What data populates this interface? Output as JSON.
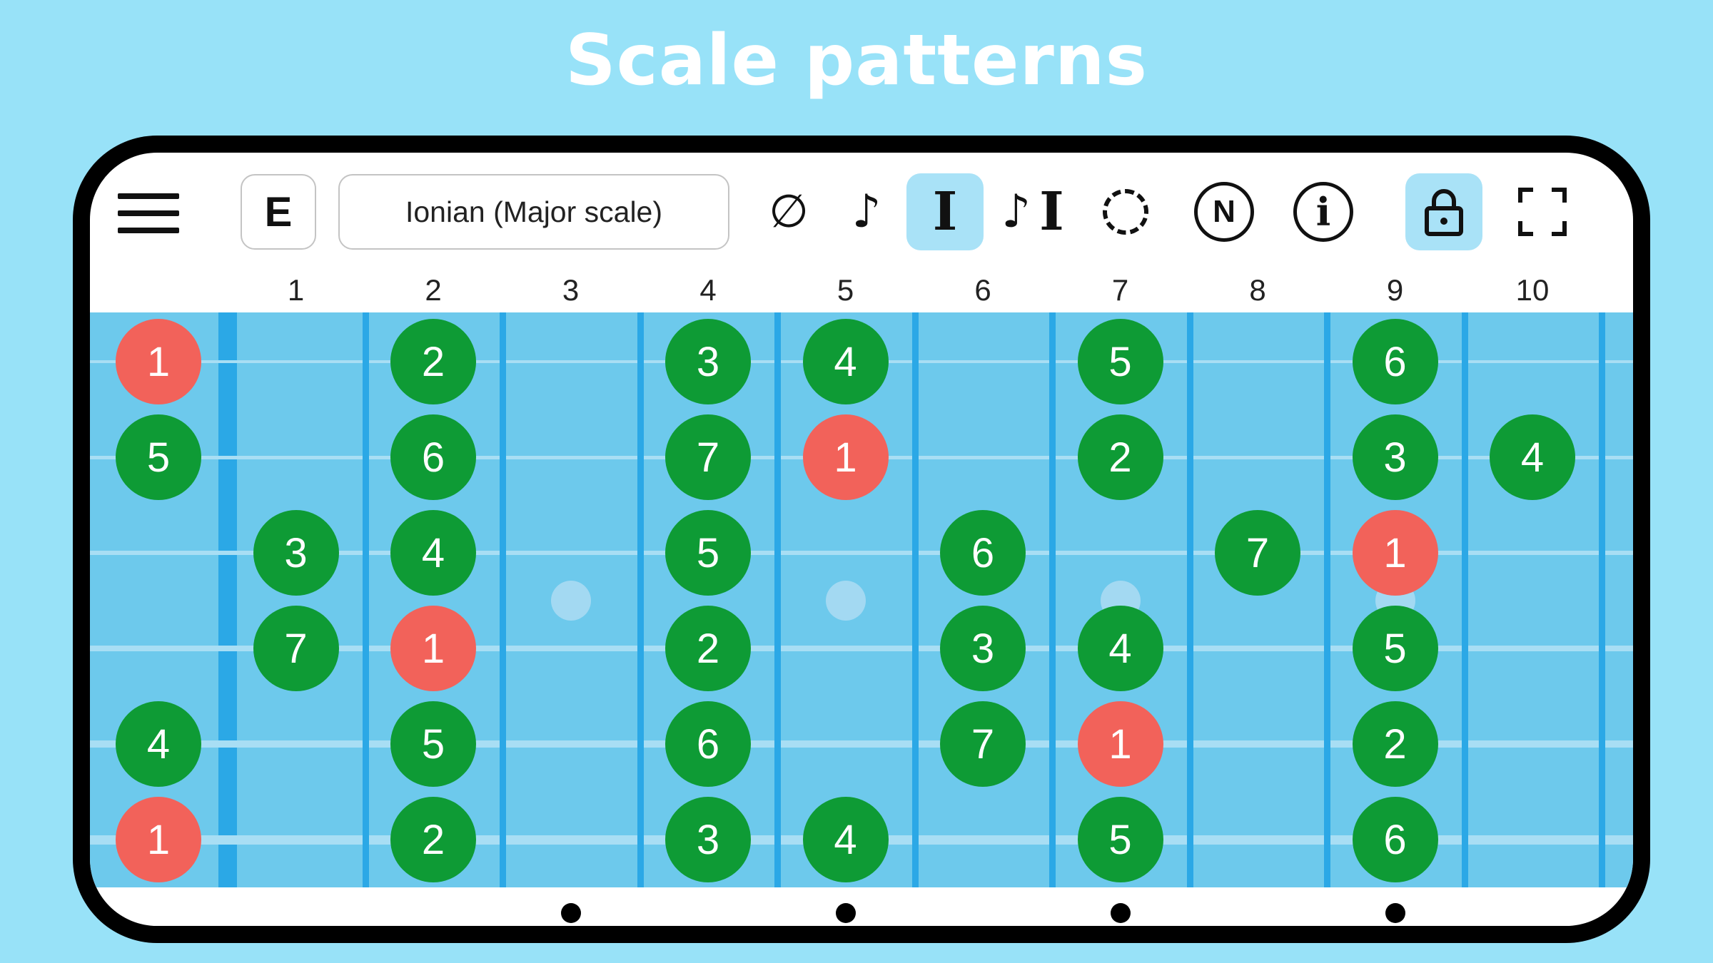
{
  "headline": "Scale patterns",
  "toolbar": {
    "menu_icon": "hamburger-menu-icon",
    "key_label": "E",
    "scale_label": "Ionian (Major scale)",
    "buttons": [
      {
        "name": "hide-notes-button",
        "icon": "empty-set-icon",
        "glyph": "∅",
        "active": false
      },
      {
        "name": "sound-button",
        "icon": "eighth-note-icon",
        "glyph": "♪",
        "active": false
      },
      {
        "name": "intervals-button",
        "icon": "interval-icon",
        "glyph": "I",
        "active": true
      },
      {
        "name": "sound-intervals-button",
        "icon": "note-interval-icon",
        "glyph": "♪",
        "glyph2": "I",
        "active": false
      },
      {
        "name": "circle-mode-button",
        "icon": "dashed-circle-icon",
        "active": false
      },
      {
        "name": "note-names-button",
        "icon": "n-circle-icon",
        "glyph": "N",
        "active": false
      },
      {
        "name": "info-button",
        "icon": "info-icon",
        "glyph": "i",
        "active": false
      },
      {
        "name": "lock-button",
        "icon": "lock-icon",
        "active": true
      },
      {
        "name": "fullscreen-button",
        "icon": "fullscreen-icon",
        "active": false
      }
    ]
  },
  "fret_numbers": [
    "1",
    "2",
    "3",
    "4",
    "5",
    "6",
    "7",
    "8",
    "9",
    "10"
  ],
  "colors": {
    "root": "#f2625a",
    "scale": "#0e9b35",
    "fretboard": "#6dc9ec",
    "fret": "#2ba8e6",
    "accent": "#a9e2f7"
  },
  "fretboard": {
    "strings": 6,
    "single_inlays": [
      3,
      5,
      7,
      9
    ],
    "bottom_markers": [
      3,
      5,
      7,
      9
    ],
    "notes": [
      {
        "string": 1,
        "fret": 0,
        "label": "1",
        "root": true
      },
      {
        "string": 1,
        "fret": 2,
        "label": "2",
        "root": false
      },
      {
        "string": 1,
        "fret": 4,
        "label": "3",
        "root": false
      },
      {
        "string": 1,
        "fret": 5,
        "label": "4",
        "root": false
      },
      {
        "string": 1,
        "fret": 7,
        "label": "5",
        "root": false
      },
      {
        "string": 1,
        "fret": 9,
        "label": "6",
        "root": false
      },
      {
        "string": 2,
        "fret": 0,
        "label": "5",
        "root": false
      },
      {
        "string": 2,
        "fret": 2,
        "label": "6",
        "root": false
      },
      {
        "string": 2,
        "fret": 4,
        "label": "7",
        "root": false
      },
      {
        "string": 2,
        "fret": 5,
        "label": "1",
        "root": true
      },
      {
        "string": 2,
        "fret": 7,
        "label": "2",
        "root": false
      },
      {
        "string": 2,
        "fret": 9,
        "label": "3",
        "root": false
      },
      {
        "string": 2,
        "fret": 10,
        "label": "4",
        "root": false
      },
      {
        "string": 3,
        "fret": 1,
        "label": "3",
        "root": false
      },
      {
        "string": 3,
        "fret": 2,
        "label": "4",
        "root": false
      },
      {
        "string": 3,
        "fret": 4,
        "label": "5",
        "root": false
      },
      {
        "string": 3,
        "fret": 6,
        "label": "6",
        "root": false
      },
      {
        "string": 3,
        "fret": 8,
        "label": "7",
        "root": false
      },
      {
        "string": 3,
        "fret": 9,
        "label": "1",
        "root": true
      },
      {
        "string": 4,
        "fret": 1,
        "label": "7",
        "root": false
      },
      {
        "string": 4,
        "fret": 2,
        "label": "1",
        "root": true
      },
      {
        "string": 4,
        "fret": 4,
        "label": "2",
        "root": false
      },
      {
        "string": 4,
        "fret": 6,
        "label": "3",
        "root": false
      },
      {
        "string": 4,
        "fret": 7,
        "label": "4",
        "root": false
      },
      {
        "string": 4,
        "fret": 9,
        "label": "5",
        "root": false
      },
      {
        "string": 5,
        "fret": 0,
        "label": "4",
        "root": false
      },
      {
        "string": 5,
        "fret": 2,
        "label": "5",
        "root": false
      },
      {
        "string": 5,
        "fret": 4,
        "label": "6",
        "root": false
      },
      {
        "string": 5,
        "fret": 6,
        "label": "7",
        "root": false
      },
      {
        "string": 5,
        "fret": 7,
        "label": "1",
        "root": true
      },
      {
        "string": 5,
        "fret": 9,
        "label": "2",
        "root": false
      },
      {
        "string": 6,
        "fret": 0,
        "label": "1",
        "root": true
      },
      {
        "string": 6,
        "fret": 2,
        "label": "2",
        "root": false
      },
      {
        "string": 6,
        "fret": 4,
        "label": "3",
        "root": false
      },
      {
        "string": 6,
        "fret": 5,
        "label": "4",
        "root": false
      },
      {
        "string": 6,
        "fret": 7,
        "label": "5",
        "root": false
      },
      {
        "string": 6,
        "fret": 9,
        "label": "6",
        "root": false
      }
    ]
  }
}
